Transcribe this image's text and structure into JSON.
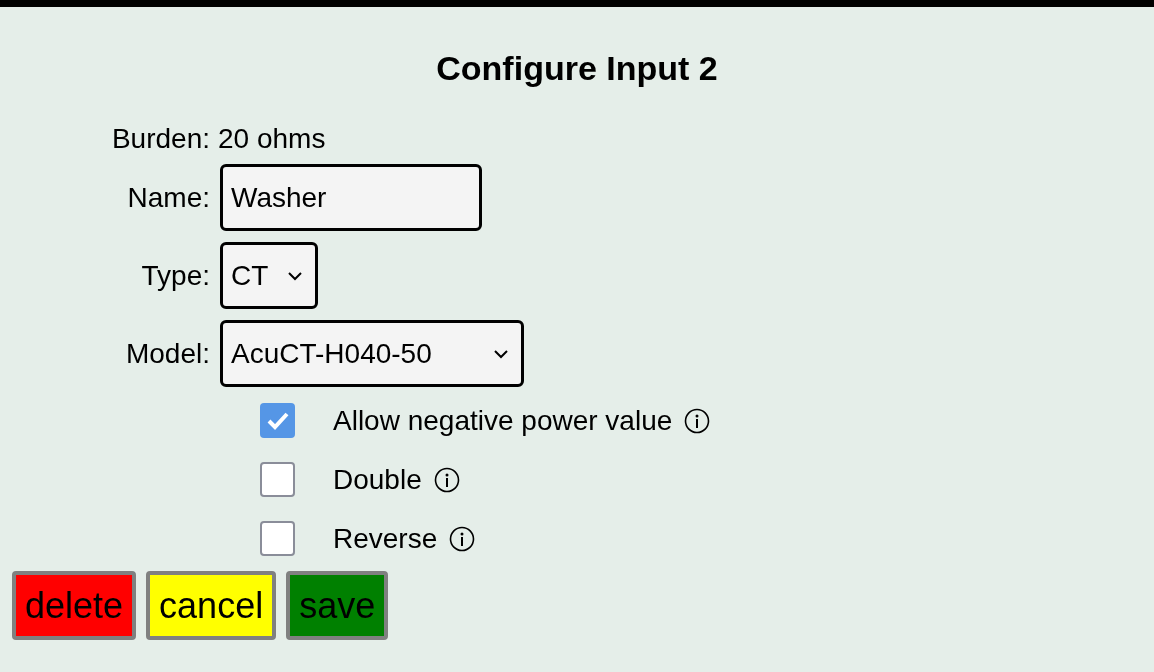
{
  "title": "Configure Input 2",
  "burden": {
    "label": "Burden:",
    "value": "20 ohms"
  },
  "fields": [
    {
      "label": "Name:",
      "kind": "text",
      "value": "Washer"
    },
    {
      "label": "Type:",
      "kind": "select",
      "value": "CT"
    },
    {
      "label": "Model:",
      "kind": "select",
      "value": "AcuCT-H040-50"
    }
  ],
  "options": [
    {
      "label": "Allow negative power value",
      "checked": true
    },
    {
      "label": "Double",
      "checked": false
    },
    {
      "label": "Reverse",
      "checked": false
    }
  ],
  "buttons": [
    {
      "label": "delete",
      "color": "#ff0000"
    },
    {
      "label": "cancel",
      "color": "#ffff00"
    },
    {
      "label": "save",
      "color": "#008000"
    }
  ]
}
